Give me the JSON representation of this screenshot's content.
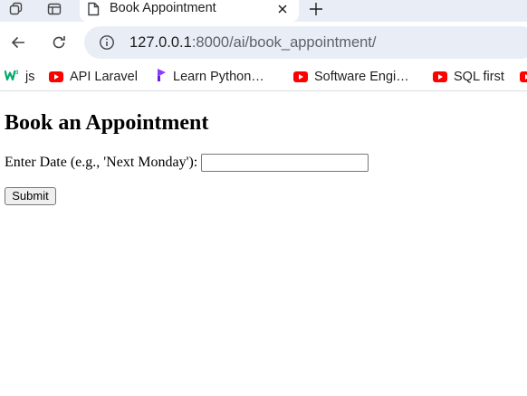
{
  "browser": {
    "tab": {
      "title": "Book Appointment"
    },
    "address_bar": {
      "host": "127.0.0.1",
      "rest": ":8000/ai/book_appointment/"
    },
    "bookmarks": [
      {
        "label": "js",
        "icon": "w3schools-icon"
      },
      {
        "label": "API Laravel",
        "icon": "youtube-icon"
      },
      {
        "label": "Learn Python…",
        "icon": "pycharm-icon"
      },
      {
        "label": "Software Engi…",
        "icon": "youtube-icon"
      },
      {
        "label": "SQL first",
        "icon": "youtube-icon"
      }
    ]
  },
  "page": {
    "heading": "Book an Appointment",
    "form": {
      "date_label": "Enter Date (e.g., 'Next Monday'):",
      "date_value": "",
      "submit_label": "Submit"
    }
  }
}
